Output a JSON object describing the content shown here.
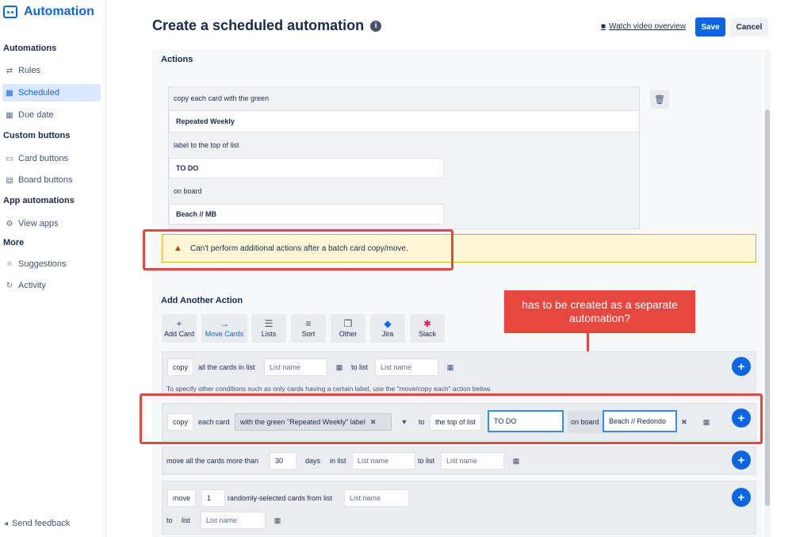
{
  "sidebar": {
    "brand": "Automation",
    "sections": {
      "automations": "Automations",
      "custom_buttons": "Custom buttons",
      "app_automations": "App automations",
      "more": "More"
    },
    "items": [
      {
        "label": "Rules",
        "icon": "rules-icon"
      },
      {
        "label": "Scheduled",
        "icon": "calendar-icon"
      },
      {
        "label": "Due date",
        "icon": "calendar-icon"
      },
      {
        "label": "Card buttons",
        "icon": "card-icon"
      },
      {
        "label": "Board buttons",
        "icon": "board-icon"
      },
      {
        "label": "View apps",
        "icon": "gear-icon"
      },
      {
        "label": "Suggestions",
        "icon": "sparkle-icon"
      },
      {
        "label": "Activity",
        "icon": "refresh-icon"
      }
    ],
    "send_feedback": "Send feedback"
  },
  "header": {
    "title": "Create a scheduled automation",
    "watch_video": "Watch video overview",
    "save": "Save",
    "cancel": "Cancel"
  },
  "actions": {
    "heading": "Actions",
    "line1": "copy each card with the green",
    "field1": "Repeated Weekly",
    "line2": "label to the top of list",
    "field2": "TO DO",
    "line3": "on board",
    "field3": "Beach // MB"
  },
  "warning": "Can't perform additional actions after a batch card copy/move.",
  "add_action": {
    "heading": "Add Another Action",
    "tools": [
      "Add Card",
      "Move Cards",
      "Lists",
      "Sort",
      "Other",
      "Jira",
      "Slack"
    ],
    "active_tool": "Move Cards"
  },
  "callout": "has to be created as a separate automation?",
  "rows": {
    "r1": {
      "op": "copy",
      "text1": "all the cards in list",
      "placeholder1": "List name",
      "to": "to list",
      "placeholder2": "List name"
    },
    "note": "To specify other conditions such as only cards having a certain label, use the \"move/copy each\" action below.",
    "r2": {
      "op": "copy",
      "text1": "each card",
      "tag": "with the green \"Repeated Weekly\" label",
      "to": "to",
      "position": "the top of list",
      "list": "TO DO",
      "on_board": "on board",
      "board": "Beach // Redondo"
    },
    "r3": {
      "text1": "move all the cards more than",
      "days_value": "30",
      "days": "days",
      "in_list": "in list",
      "placeholder1": "List name",
      "to_list": "to list",
      "placeholder2": "List name"
    },
    "r4": {
      "op": "move",
      "count": "1",
      "text1": "randomly-selected cards from list",
      "placeholder1": "List name",
      "to": "to",
      "list": "list",
      "placeholder2": "List name"
    }
  },
  "colors": {
    "accent": "#0c66e4",
    "annotation": "#e5483e",
    "warning_bg": "#fff7d6"
  }
}
